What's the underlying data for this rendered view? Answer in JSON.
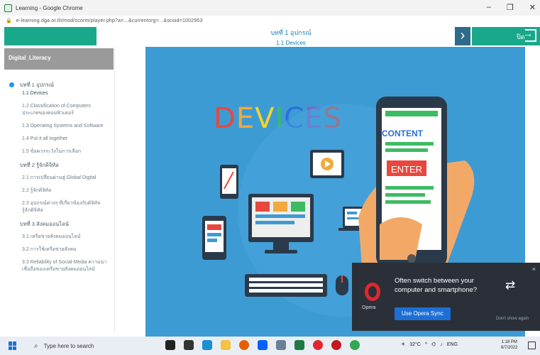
{
  "browser": {
    "window_title": "Learning - Google Chrome",
    "url": "e-learning.dga.or.th/mod/scorm/player.php?a=...&currentorg=...&scoid=1002953",
    "controls": {
      "minimize": "–",
      "maximize": "❐",
      "close": "✕"
    }
  },
  "header": {
    "chapter": "บทที่ 1 อุปกรณ์",
    "lesson": "1.1 Devices",
    "next_glyph": "›",
    "exit_label": "ปิด",
    "accent_color": "#1aa88a",
    "next_color": "#2e6b8a"
  },
  "sidebar": {
    "course_title": "Digital_Literacy",
    "items": [
      {
        "label": "บทที่ 1 อุปกรณ์",
        "kind": "chapter",
        "active": true
      },
      {
        "label": "1.1 Devices",
        "kind": "sub"
      },
      {
        "label": "1.2 Classification of Computers ประเภทของคอมพิวเตอร์",
        "kind": "sub"
      },
      {
        "label": "1.3 Operating Systems and Software",
        "kind": "sub"
      },
      {
        "label": "1.4 Put it all together",
        "kind": "sub"
      },
      {
        "label": "1.5 ข้อควรระวังในการเลือก",
        "kind": "sub"
      },
      {
        "label": "บทที่ 2 รู้จักดิจิทัล",
        "kind": "chapter"
      },
      {
        "label": "2.1 การเปลี่ยนผ่านสู่ Global Digital",
        "kind": "sub"
      },
      {
        "label": "2.2 รู้จักดิจิทัล",
        "kind": "sub"
      },
      {
        "label": "2.3 อุปกรณ์ต่างๆ ที่เกี่ยวข้องกับดิจิทัล รู้จักดิจิทัล",
        "kind": "sub"
      },
      {
        "label": "บทที่ 3 สังคมออนไลน์",
        "kind": "chapter"
      },
      {
        "label": "3.1 เครือข่ายสังคมออนไลน์",
        "kind": "sub"
      },
      {
        "label": "3.2 การใช้เครือข่ายสังคม",
        "kind": "sub"
      },
      {
        "label": "3.3 Reliability of Social Media ความน่าเชื่อถือของเครือข่ายสังคมออนไลน์",
        "kind": "sub"
      }
    ]
  },
  "slide": {
    "background_color": "#3d9bd4",
    "title_letters": [
      {
        "ch": "D",
        "color": "#e8473e"
      },
      {
        "ch": "E",
        "color": "#f2a93b"
      },
      {
        "ch": "V",
        "color": "#f5d423"
      },
      {
        "ch": "I",
        "color": "#3dbb63"
      },
      {
        "ch": "C",
        "color": "#2c6fd9"
      },
      {
        "ch": "E",
        "color": "#8b5cc9"
      },
      {
        "ch": "S",
        "color": "#e8473e"
      }
    ],
    "phone_content_label": "CONTENT",
    "phone_button_label": "ENTER"
  },
  "opera_popup": {
    "brand": "Opera",
    "message": "Often switch between your computer and smartphone?",
    "button_label": "Use Opera Sync",
    "dismiss_label": "Don't show again",
    "close_glyph": "×",
    "sync_glyph": "⇄",
    "brand_color": "#e3262e"
  },
  "taskbar": {
    "search_placeholder": "Type here to search",
    "weather": "32°C",
    "language": "ENG",
    "time": "1:18 PM",
    "date": "6/7/2022",
    "pinned_icons": [
      {
        "name": "cortana-icon",
        "color": "#222222"
      },
      {
        "name": "task-view-icon",
        "color": "#333333"
      },
      {
        "name": "edge-icon",
        "color": "#1b8fd6"
      },
      {
        "name": "file-explorer-icon",
        "color": "#f2c244"
      },
      {
        "name": "firefox-icon",
        "color": "#e66000"
      },
      {
        "name": "dropbox-icon",
        "color": "#0061fe"
      },
      {
        "name": "settings-icon",
        "color": "#6a7f95"
      },
      {
        "name": "excel-icon",
        "color": "#1f7a44"
      },
      {
        "name": "opera-icon",
        "color": "#e3262e"
      },
      {
        "name": "opera-gx-icon",
        "color": "#c4171f"
      },
      {
        "name": "chrome-icon",
        "color": "#33a853"
      }
    ]
  }
}
